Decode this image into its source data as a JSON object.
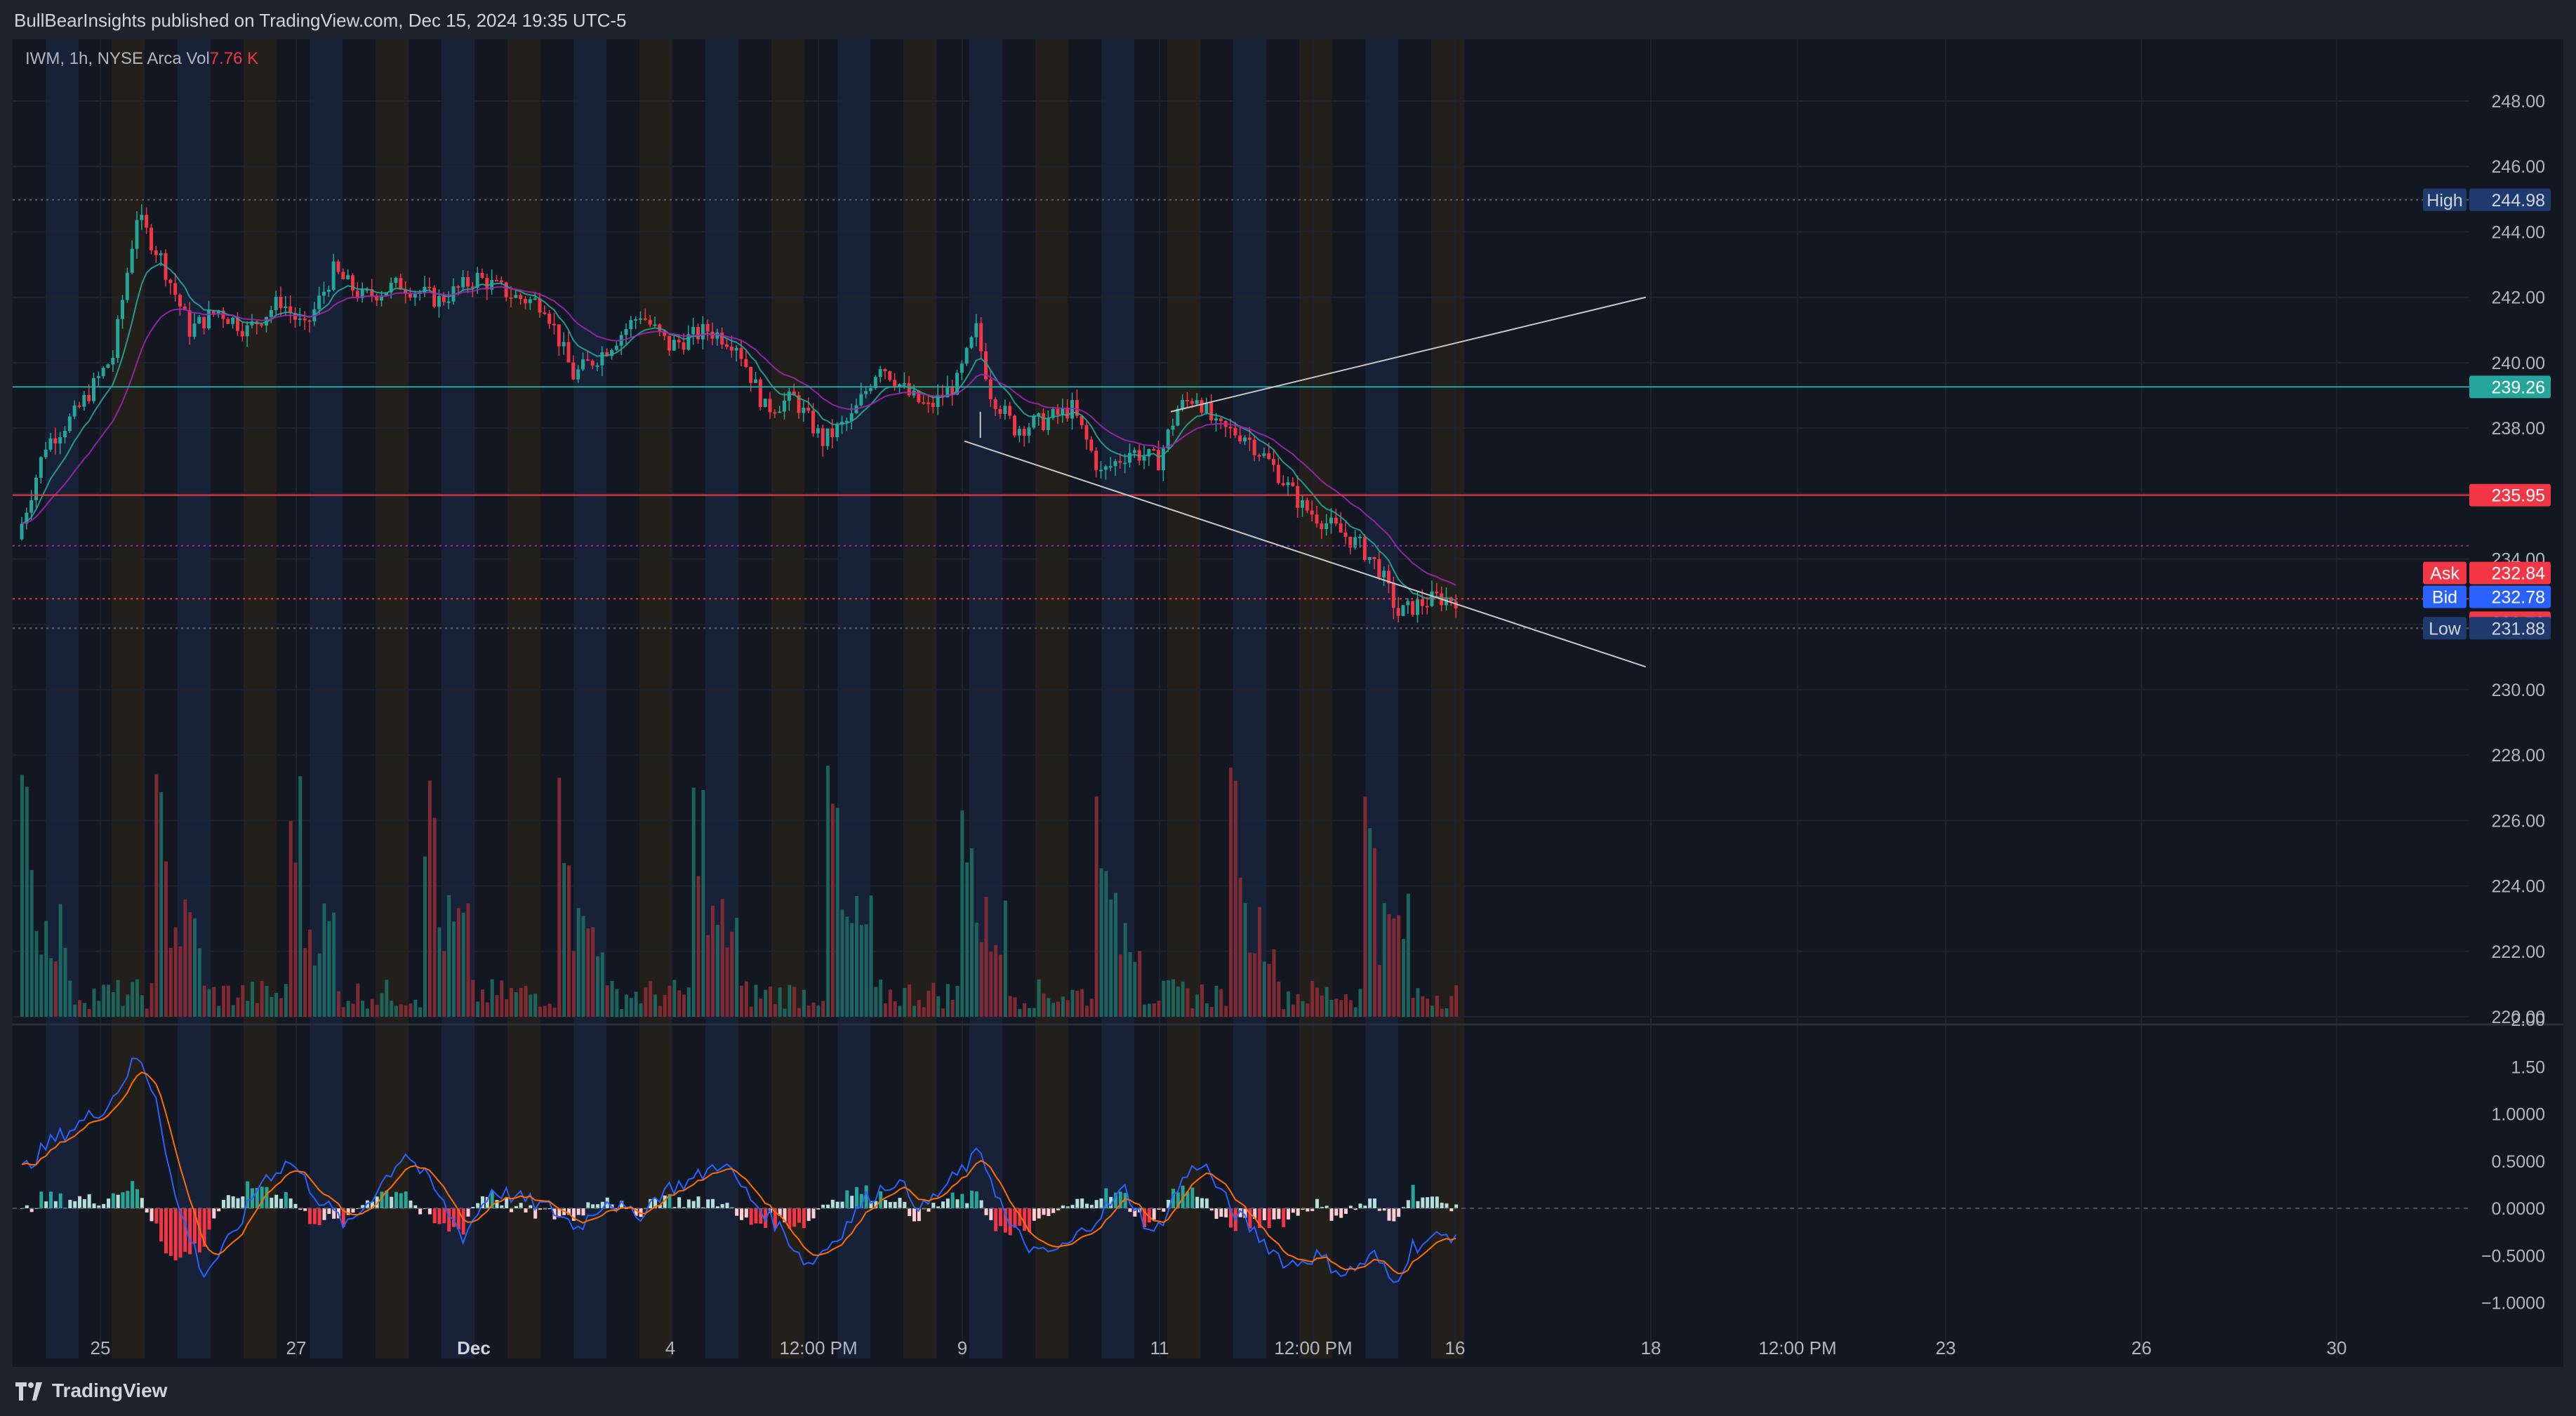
{
  "header": {
    "publisher": "BullBearInsights published on TradingView.com, Dec 15, 2024 19:35 UTC-5"
  },
  "symbol": {
    "info": "IWM, 1h, NYSE Arca",
    "vol_label": "Vol",
    "vol_value": "7.76 K"
  },
  "footer": {
    "brand": "TradingView"
  },
  "colors": {
    "up": "#26a69a",
    "down": "#f23645",
    "pane": "#131722",
    "text": "#b2b5be",
    "ema_fast": "#26a69a",
    "ema_slow": "#9c27b0",
    "macd": "#2962ff",
    "signal": "#ff6d00",
    "trendline": "#c8c8c8",
    "ask": "#f23645",
    "bid": "#2962ff",
    "label_blue": "#1e3a6e"
  },
  "chart_data": {
    "type": "candlestick",
    "price_axis": {
      "ylim": [
        220,
        249
      ],
      "ticks": [
        "220.00",
        "222.00",
        "224.00",
        "226.00",
        "228.00",
        "230.00",
        "232.00",
        "234.00",
        "236.00",
        "238.00",
        "240.00",
        "242.00",
        "244.00",
        "246.00",
        "248.00"
      ]
    },
    "time_axis": {
      "ticks": [
        "25",
        "27",
        "Dec",
        "4",
        "12:00 PM",
        "9",
        "11",
        "12:00 PM",
        "16",
        "18",
        "12:00 PM",
        "23",
        "26",
        "30"
      ]
    },
    "price_labels": [
      {
        "name": "High",
        "value": "244.98",
        "kind": "high"
      },
      {
        "name": "",
        "value": "239.26",
        "kind": "green"
      },
      {
        "name": "",
        "value": "235.95",
        "kind": "red"
      },
      {
        "name": "Ask",
        "value": "232.84",
        "kind": "ask"
      },
      {
        "name": "Bid",
        "value": "232.78",
        "kind": "bid"
      },
      {
        "name": "",
        "value": "232.78",
        "kind": "last"
      },
      {
        "name": "Low",
        "value": "231.88",
        "kind": "low"
      }
    ],
    "horizontal_lines": [
      {
        "price": 239.26,
        "style": "solid",
        "color": "#26a69a"
      },
      {
        "price": 235.95,
        "style": "solid",
        "color": "#f23645"
      },
      {
        "price": 244.98,
        "style": "dotted",
        "color": "#5d606b"
      },
      {
        "price": 234.4,
        "style": "dotted",
        "color": "#9c27b0"
      },
      {
        "price": 232.78,
        "style": "dotted",
        "color": "#f23645"
      },
      {
        "price": 231.88,
        "style": "dotted",
        "color": "#5d606b"
      }
    ],
    "trendlines": [
      {
        "from": [
          240.0,
          238.5
        ],
        "to": [
          260.0,
          242.0
        ]
      },
      {
        "from": [
          197.0,
          237.6
        ],
        "to": [
          260.0,
          230.7
        ]
      }
    ],
    "macd_axis": {
      "ticks": [
        "2.00",
        "1.50",
        "1.0000",
        "0.5000",
        "0.0000",
        "−0.5000",
        "−1.0000"
      ],
      "ylim": [
        -1.3,
        2.1
      ]
    },
    "series_keypoints": [
      [
        0,
        234.6
      ],
      [
        6,
        237.5
      ],
      [
        12,
        238.4
      ],
      [
        16,
        239.3
      ],
      [
        20,
        240.2
      ],
      [
        25,
        244.5
      ],
      [
        30,
        243.2
      ],
      [
        36,
        241.0
      ],
      [
        42,
        241.6
      ],
      [
        48,
        241.0
      ],
      [
        55,
        241.9
      ],
      [
        60,
        241.0
      ],
      [
        66,
        242.8
      ],
      [
        72,
        242.0
      ],
      [
        80,
        242.4
      ],
      [
        88,
        241.9
      ],
      [
        96,
        242.6
      ],
      [
        104,
        242.0
      ],
      [
        110,
        241.8
      ],
      [
        116,
        239.6
      ],
      [
        122,
        240.3
      ],
      [
        130,
        241.5
      ],
      [
        136,
        240.5
      ],
      [
        144,
        241.0
      ],
      [
        150,
        240.6
      ],
      [
        156,
        238.6
      ],
      [
        162,
        238.9
      ],
      [
        168,
        237.6
      ],
      [
        174,
        238.3
      ],
      [
        180,
        240.0
      ],
      [
        186,
        239.0
      ],
      [
        190,
        238.6
      ],
      [
        196,
        239.4
      ],
      [
        200,
        241.0
      ],
      [
        203,
        239.1
      ],
      [
        208,
        238.0
      ],
      [
        214,
        238.2
      ],
      [
        220,
        238.6
      ],
      [
        226,
        236.6
      ],
      [
        232,
        237.3
      ],
      [
        238,
        237.0
      ],
      [
        242,
        238.6
      ],
      [
        246,
        239.0
      ],
      [
        250,
        238.0
      ],
      [
        256,
        237.8
      ],
      [
        262,
        236.8
      ],
      [
        268,
        235.6
      ],
      [
        274,
        235.0
      ],
      [
        280,
        234.4
      ],
      [
        284,
        233.7
      ],
      [
        288,
        232.3
      ],
      [
        292,
        232.6
      ],
      [
        296,
        232.8
      ],
      [
        300,
        232.78
      ]
    ],
    "macd_keypoints": [
      [
        0,
        0.4
      ],
      [
        6,
        0.7
      ],
      [
        12,
        0.9
      ],
      [
        18,
        1.1
      ],
      [
        24,
        1.6
      ],
      [
        28,
        1.2
      ],
      [
        32,
        0.1
      ],
      [
        38,
        -0.7
      ],
      [
        44,
        -0.3
      ],
      [
        50,
        0.3
      ],
      [
        56,
        0.5
      ],
      [
        62,
        0.1
      ],
      [
        68,
        -0.2
      ],
      [
        74,
        0.2
      ],
      [
        80,
        0.6
      ],
      [
        86,
        0.2
      ],
      [
        92,
        -0.3
      ],
      [
        98,
        0.2
      ],
      [
        104,
        0.1
      ],
      [
        110,
        0.0
      ],
      [
        116,
        -0.2
      ],
      [
        122,
        0.1
      ],
      [
        128,
        -0.1
      ],
      [
        134,
        0.2
      ],
      [
        140,
        0.3
      ],
      [
        146,
        0.5
      ],
      [
        152,
        0.1
      ],
      [
        158,
        -0.2
      ],
      [
        164,
        -0.6
      ],
      [
        170,
        -0.3
      ],
      [
        176,
        0.1
      ],
      [
        182,
        0.3
      ],
      [
        188,
        0.0
      ],
      [
        194,
        0.3
      ],
      [
        200,
        0.6
      ],
      [
        206,
        -0.2
      ],
      [
        212,
        -0.5
      ],
      [
        218,
        -0.4
      ],
      [
        224,
        -0.1
      ],
      [
        230,
        0.2
      ],
      [
        236,
        -0.3
      ],
      [
        242,
        0.3
      ],
      [
        246,
        0.5
      ],
      [
        252,
        0.0
      ],
      [
        258,
        -0.3
      ],
      [
        264,
        -0.6
      ],
      [
        270,
        -0.5
      ],
      [
        276,
        -0.7
      ],
      [
        282,
        -0.5
      ],
      [
        286,
        -0.8
      ],
      [
        290,
        -0.4
      ],
      [
        296,
        -0.3
      ],
      [
        300,
        -0.25
      ]
    ],
    "bars_count": 300
  }
}
